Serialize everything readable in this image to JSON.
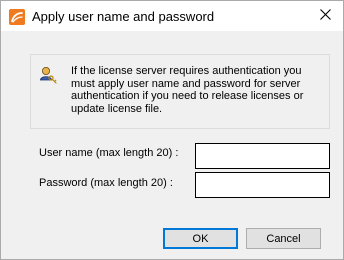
{
  "window": {
    "title": "Apply user name and password",
    "app_icon": "app-logo-icon",
    "close_glyph": "✕"
  },
  "info": {
    "icon": "key-user-icon",
    "message": "If the license server requires authentication you must apply user name and password for server authentication if you need to release licenses or update license file."
  },
  "form": {
    "username_label": "User name (max length 20) :",
    "username_value": "",
    "password_label": "Password (max length 20) :",
    "password_value": ""
  },
  "buttons": {
    "ok_label": "OK",
    "cancel_label": "Cancel"
  }
}
